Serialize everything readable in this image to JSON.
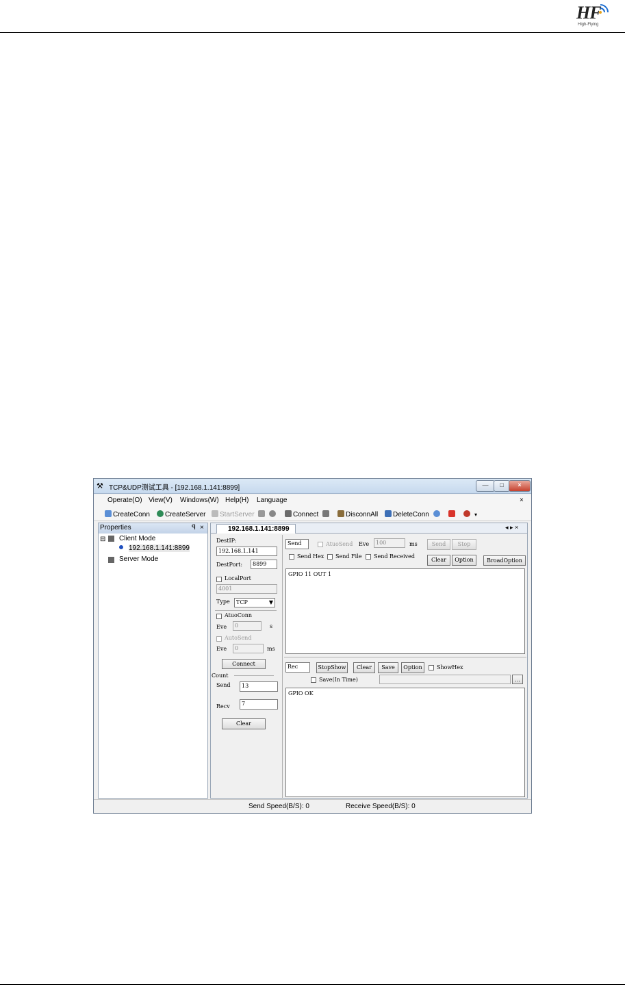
{
  "logo": {
    "text": "HF",
    "sub": "High-Flying"
  },
  "window": {
    "title": "TCP&UDP测试工具 - [192.168.1.141:8899]",
    "minimize": "—",
    "maximize": "□",
    "close": "×",
    "menu": [
      "Operate(O)",
      "View(V)",
      "Windows(W)",
      "Help(H)",
      "Language"
    ],
    "menu_close": "×",
    "toolbar": {
      "create_conn": "CreateConn",
      "create_server": "CreateServer",
      "start_server": "StartServer",
      "connect": "Connect",
      "disconn_all": "DisconnAll",
      "delete_conn": "DeleteConn"
    },
    "colors": {
      "title_bg": "#c6d9ee",
      "close_btn": "#c7412e",
      "node": "#1f4fbf"
    }
  },
  "properties": {
    "title": "Properties",
    "pin": "ꟼ",
    "close": "×",
    "tree": {
      "client_mode": "Client Mode",
      "client_conn": "192.168.1.141:8899",
      "server_mode": "Server Mode"
    }
  },
  "doc": {
    "tab": "192.168.1.141:8899",
    "nav": "◂ ▸ ×"
  },
  "conn": {
    "destip_label": "DestIP:",
    "destip": "192.168.1.141",
    "destport_label": "DestPort:",
    "destport": "8899",
    "localport_label": "LocalPort",
    "localport": "4001",
    "type_label": "Type",
    "type_value": "TCP",
    "autoconn_label": "AtuoConn",
    "every1_label": "Eve",
    "every1_value": "0",
    "unit_s": "s",
    "autosend_label": "AutoSend",
    "every2_label": "Eve",
    "every2_value": "0",
    "unit_ms": "ms",
    "connect_btn": "Connect",
    "count_label": "Count",
    "send_label": "Send",
    "send_count": "13",
    "recv_label": "Recv",
    "recv_count": "7",
    "clear_btn": "Clear"
  },
  "send_panel": {
    "send_field": "Send",
    "autosend_label": "AtuoSend",
    "eve_label": "Eve",
    "interval": "100",
    "unit": "ms",
    "send_btn": "Send",
    "stop_btn": "Stop",
    "send_hex": "Send Hex",
    "send_file": "Send File",
    "send_received": "Send Received",
    "clear_btn": "Clear",
    "option_btn": "Option",
    "broad_btn": "BroadOption",
    "content": "GPIO 11 OUT 1"
  },
  "recv_panel": {
    "rec_field": "Rec",
    "stopshow_btn": "StopShow",
    "clear_btn": "Clear",
    "save_btn": "Save",
    "option_btn": "Option",
    "showhex": "ShowHex",
    "save_intime": "Save(In Time)",
    "browse_btn": "...",
    "content": "GPIO OK"
  },
  "status": {
    "send_speed": "Send Speed(B/S): 0",
    "recv_speed": "Receive Speed(B/S): 0"
  }
}
